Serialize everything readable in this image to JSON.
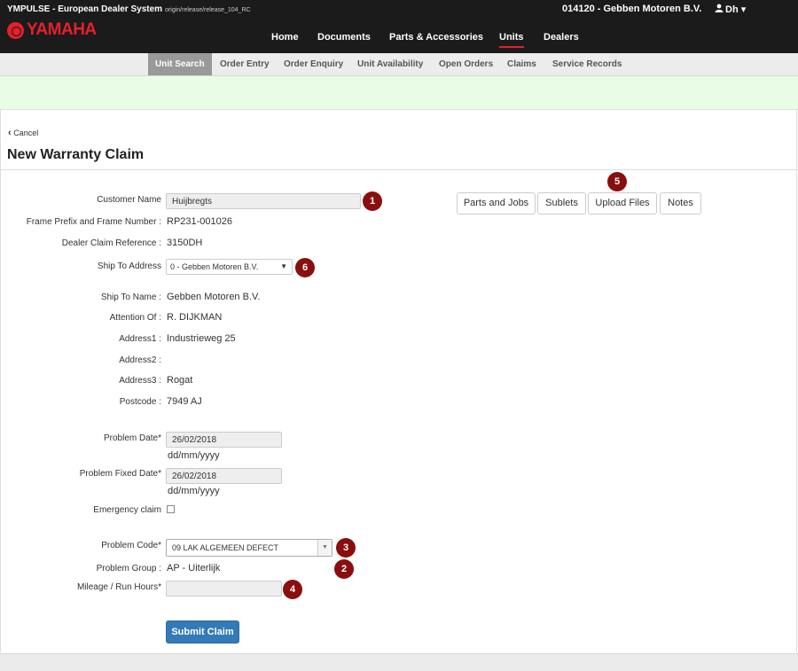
{
  "header": {
    "app_title": "YMPULSE - European Dealer System",
    "branch": "origin/release/release_104_RC",
    "dealer": "014120 - Gebben Motoren B.V.",
    "user": "Dh",
    "user_caret": "▾",
    "user_icon": "user-icon",
    "logo_text": "YAMAHA"
  },
  "main_nav": [
    "Home",
    "Documents",
    "Parts & Accessories",
    "Units",
    "Dealers"
  ],
  "main_nav_active": "Units",
  "sub_nav": [
    "Unit Search",
    "Order Entry",
    "Order Enquiry",
    "Unit Availability",
    "Open Orders",
    "Claims",
    "Service Records"
  ],
  "sub_nav_active": "Unit Search",
  "page": {
    "cancel_label": "Cancel",
    "cancel_icon": "‹",
    "title": "New Warranty Claim"
  },
  "form": {
    "customer_name": {
      "label": "Customer Name",
      "value": "Huijbregts"
    },
    "frame": {
      "label": "Frame Prefix and Frame Number :",
      "value": "RP231-001026"
    },
    "dealer_ref": {
      "label": "Dealer Claim Reference :",
      "value": "3150DH"
    },
    "ship_to_address": {
      "label": "Ship To Address",
      "value": "0 - Gebben Motoren B.V.",
      "arrow": "▼"
    },
    "ship_to_name": {
      "label": "Ship To Name :",
      "value": "Gebben Motoren B.V."
    },
    "attention_of": {
      "label": "Attention Of :",
      "value": "R. DIJKMAN"
    },
    "address1": {
      "label": "Address1 :",
      "value": "Industrieweg 25"
    },
    "address2": {
      "label": "Address2 :",
      "value": ""
    },
    "address3": {
      "label": "Address3 :",
      "value": "Rogat"
    },
    "postcode": {
      "label": "Postcode :",
      "value": "7949 AJ"
    },
    "problem_date": {
      "label": "Problem Date*",
      "value": "26/02/2018",
      "hint": "dd/mm/yyyy"
    },
    "problem_fixed_date": {
      "label": "Problem Fixed Date*",
      "value": "26/02/2018",
      "hint": "dd/mm/yyyy"
    },
    "emergency_claim": {
      "label": "Emergency claim",
      "checked": false
    },
    "problem_code": {
      "label": "Problem Code*",
      "value": "09 LAK ALGEMEEN DEFECT",
      "arrow": "▼"
    },
    "problem_group": {
      "label": "Problem Group :",
      "value": "AP - Uiterlijk"
    },
    "mileage": {
      "label": "Mileage / Run Hours*",
      "value": ""
    },
    "submit_label": "Submit Claim"
  },
  "tab_buttons": [
    "Parts and Jobs",
    "Sublets",
    "Upload Files",
    "Notes"
  ],
  "annotations": [
    "1",
    "2",
    "3",
    "4",
    "5",
    "6"
  ],
  "colors": {
    "topbar": "#1b1b1b",
    "brand_red": "#e4202e",
    "badge": "#8b0e0e",
    "primary_button": "#337ab7",
    "alert_bg": "#e9fde6"
  }
}
